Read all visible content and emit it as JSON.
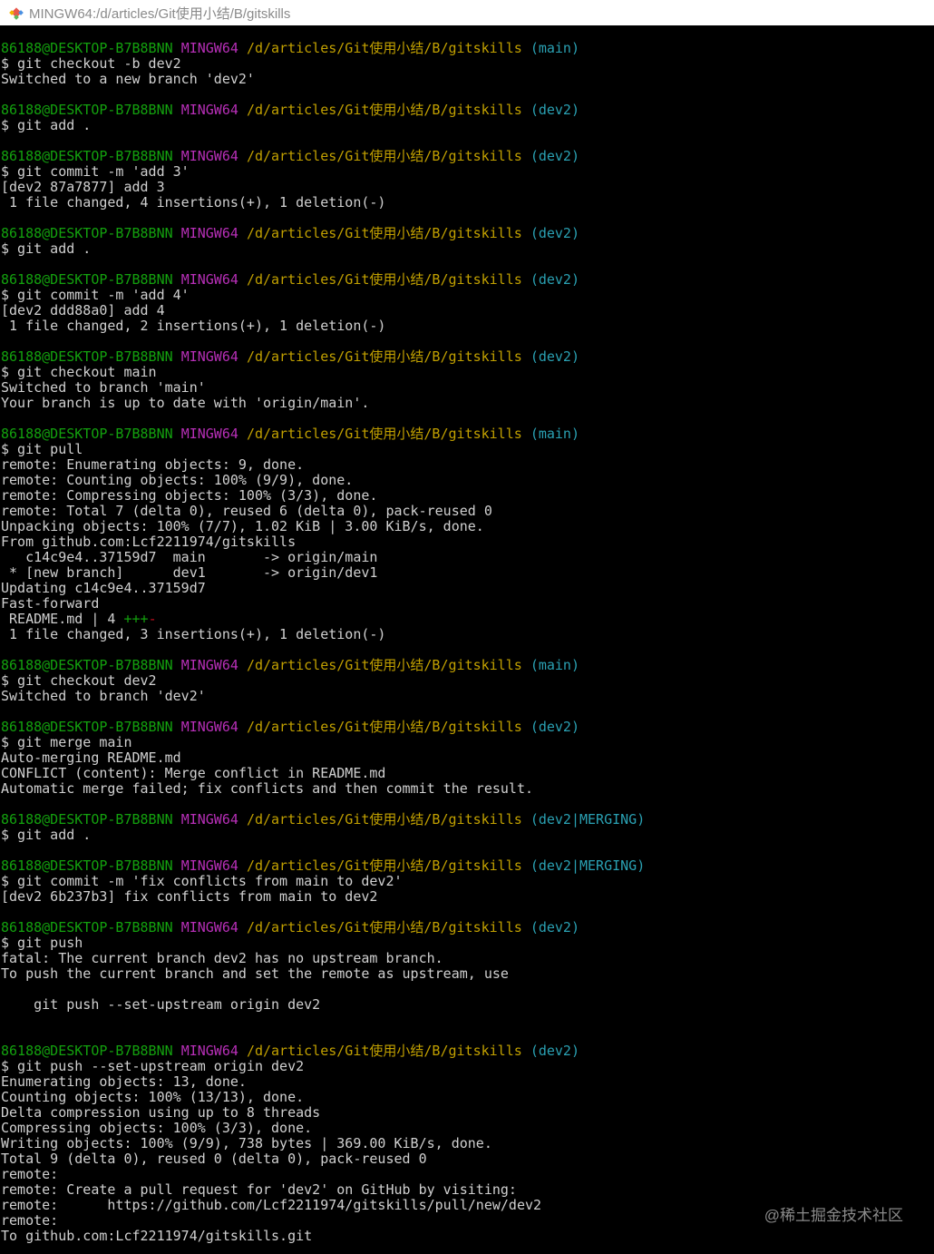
{
  "window": {
    "title": "MINGW64:/d/articles/Git使用小结/B/gitskills"
  },
  "prompt": {
    "user": "86188@DESKTOP-B7B8BNN",
    "env": "MINGW64",
    "path": "/d/articles/Git使用小结/B/gitskills"
  },
  "lines": [
    {
      "p": "(main)"
    },
    {
      "t": "$ git checkout -b dev2"
    },
    {
      "t": "Switched to a new branch 'dev2'"
    },
    {
      "t": ""
    },
    {
      "p": "(dev2)"
    },
    {
      "t": "$ git add ."
    },
    {
      "t": ""
    },
    {
      "p": "(dev2)"
    },
    {
      "t": "$ git commit -m 'add 3'"
    },
    {
      "t": "[dev2 87a7877] add 3"
    },
    {
      "t": " 1 file changed, 4 insertions(+), 1 deletion(-)"
    },
    {
      "t": ""
    },
    {
      "p": "(dev2)"
    },
    {
      "t": "$ git add ."
    },
    {
      "t": ""
    },
    {
      "p": "(dev2)"
    },
    {
      "t": "$ git commit -m 'add 4'"
    },
    {
      "t": "[dev2 ddd88a0] add 4"
    },
    {
      "t": " 1 file changed, 2 insertions(+), 1 deletion(-)"
    },
    {
      "t": ""
    },
    {
      "p": "(dev2)"
    },
    {
      "t": "$ git checkout main"
    },
    {
      "t": "Switched to branch 'main'"
    },
    {
      "t": "Your branch is up to date with 'origin/main'."
    },
    {
      "t": ""
    },
    {
      "p": "(main)"
    },
    {
      "t": "$ git pull"
    },
    {
      "t": "remote: Enumerating objects: 9, done."
    },
    {
      "t": "remote: Counting objects: 100% (9/9), done."
    },
    {
      "t": "remote: Compressing objects: 100% (3/3), done."
    },
    {
      "t": "remote: Total 7 (delta 0), reused 6 (delta 0), pack-reused 0"
    },
    {
      "t": "Unpacking objects: 100% (7/7), 1.02 KiB | 3.00 KiB/s, done."
    },
    {
      "t": "From github.com:Lcf2211974/gitskills"
    },
    {
      "t": "   c14c9e4..37159d7  main       -> origin/main"
    },
    {
      "t": " * [new branch]      dev1       -> origin/dev1"
    },
    {
      "t": "Updating c14c9e4..37159d7"
    },
    {
      "t": "Fast-forward"
    },
    {
      "t": " README.md | 4 ",
      "add": "+++",
      "del": "-"
    },
    {
      "t": " 1 file changed, 3 insertions(+), 1 deletion(-)"
    },
    {
      "t": ""
    },
    {
      "p": "(main)"
    },
    {
      "t": "$ git checkout dev2"
    },
    {
      "t": "Switched to branch 'dev2'"
    },
    {
      "t": ""
    },
    {
      "p": "(dev2)"
    },
    {
      "t": "$ git merge main"
    },
    {
      "t": "Auto-merging README.md"
    },
    {
      "t": "CONFLICT (content): Merge conflict in README.md"
    },
    {
      "t": "Automatic merge failed; fix conflicts and then commit the result."
    },
    {
      "t": ""
    },
    {
      "p": "(dev2|MERGING)"
    },
    {
      "t": "$ git add ."
    },
    {
      "t": ""
    },
    {
      "p": "(dev2|MERGING)"
    },
    {
      "t": "$ git commit -m 'fix conflicts from main to dev2'"
    },
    {
      "t": "[dev2 6b237b3] fix conflicts from main to dev2"
    },
    {
      "t": ""
    },
    {
      "p": "(dev2)"
    },
    {
      "t": "$ git push"
    },
    {
      "t": "fatal: The current branch dev2 has no upstream branch."
    },
    {
      "t": "To push the current branch and set the remote as upstream, use"
    },
    {
      "t": ""
    },
    {
      "t": "    git push --set-upstream origin dev2"
    },
    {
      "t": ""
    },
    {
      "t": ""
    },
    {
      "p": "(dev2)"
    },
    {
      "t": "$ git push --set-upstream origin dev2"
    },
    {
      "t": "Enumerating objects: 13, done."
    },
    {
      "t": "Counting objects: 100% (13/13), done."
    },
    {
      "t": "Delta compression using up to 8 threads"
    },
    {
      "t": "Compressing objects: 100% (3/3), done."
    },
    {
      "t": "Writing objects: 100% (9/9), 738 bytes | 369.00 KiB/s, done."
    },
    {
      "t": "Total 9 (delta 0), reused 0 (delta 0), pack-reused 0"
    },
    {
      "t": "remote:"
    },
    {
      "t": "remote: Create a pull request for 'dev2' on GitHub by visiting:"
    },
    {
      "t": "remote:      https://github.com/Lcf2211974/gitskills/pull/new/dev2"
    },
    {
      "t": "remote:"
    },
    {
      "t": "To github.com:Lcf2211974/gitskills.git"
    }
  ],
  "watermark": "@稀土掘金技术社区"
}
